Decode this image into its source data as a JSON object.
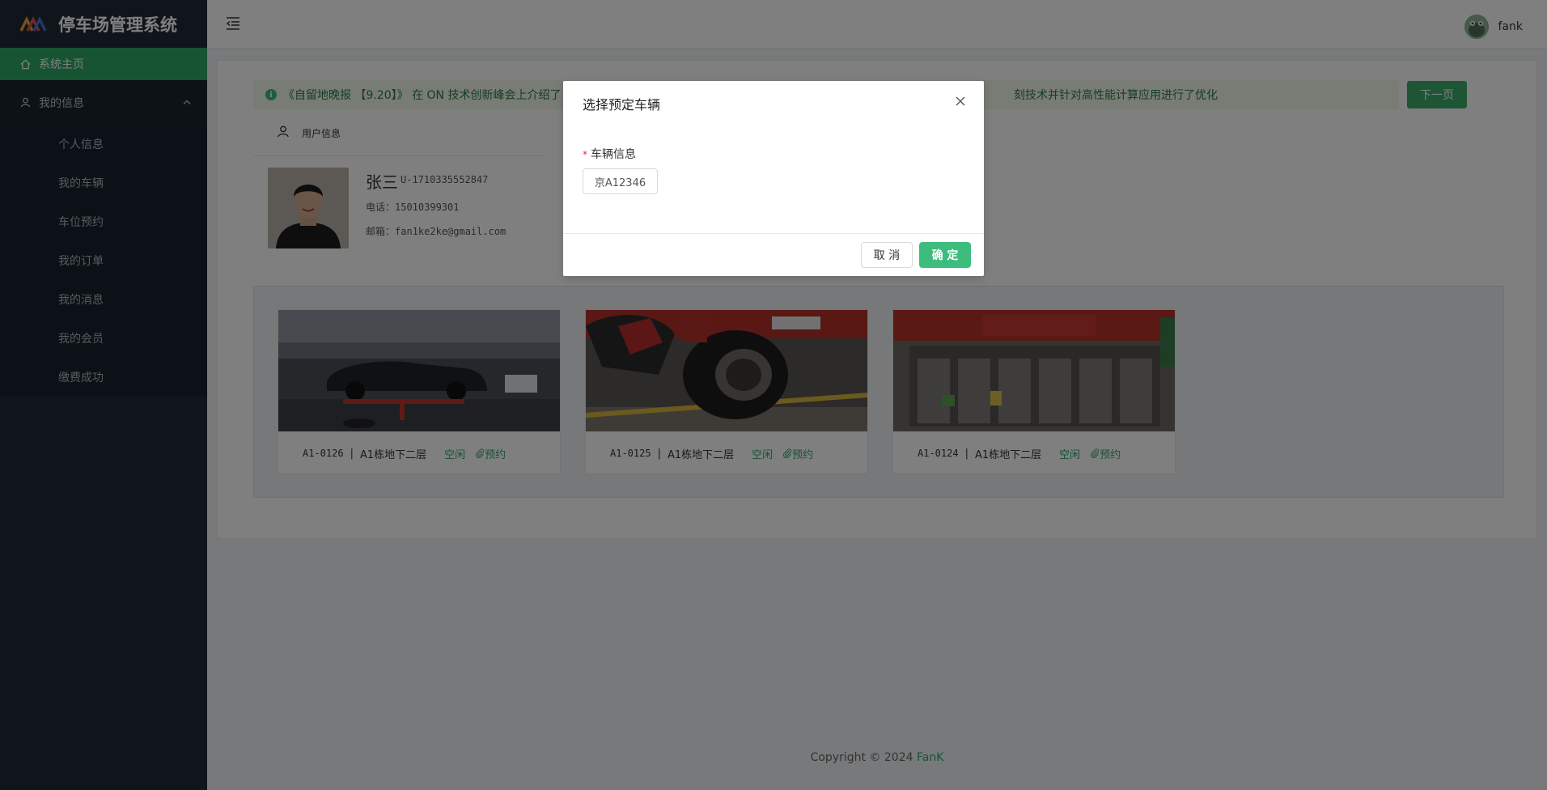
{
  "app": {
    "title": "停车场管理系统"
  },
  "sidebar": {
    "home": "系统主页",
    "my_info": "我的信息",
    "items": [
      {
        "label": "个人信息"
      },
      {
        "label": "我的车辆"
      },
      {
        "label": "车位预约"
      },
      {
        "label": "我的订单"
      },
      {
        "label": "我的消息"
      },
      {
        "label": "我的会员"
      },
      {
        "label": "缴费成功"
      }
    ]
  },
  "header": {
    "username": "fank"
  },
  "notice": {
    "text_left": "《自留地晚报 【9.20】》 在 ON 技术创新峰会上介绍了",
    "text_right": "刻技术并针对高性能计算应用进行了优化",
    "next_button": "下一页"
  },
  "profile": {
    "tab": "用户信息",
    "name": "张三",
    "id": "U-1710335552847",
    "phone": "电话：15010399301",
    "email": "邮箱：fan1ke2ke@gmail.com"
  },
  "spaces": [
    {
      "code": "A1-0126",
      "location": "A1栋地下二层",
      "status": "空闲",
      "action": "预约"
    },
    {
      "code": "A1-0125",
      "location": "A1栋地下二层",
      "status": "空闲",
      "action": "预约"
    },
    {
      "code": "A1-0124",
      "location": "A1栋地下二层",
      "status": "空闲",
      "action": "预约"
    }
  ],
  "footer": {
    "copyright": "Copyright © 2024 ",
    "brand": "FanK"
  },
  "modal": {
    "title": "选择预定车辆",
    "field_label": "车辆信息",
    "vehicle": "京A12346",
    "cancel": "取 消",
    "confirm": "确 定"
  },
  "colors": {
    "primary": "#2ea867",
    "sidebar_bg": "#1e2b36",
    "required": "#f5222d"
  },
  "icons": {
    "home": "home-icon",
    "user": "user-icon",
    "menu": "menu-fold-icon",
    "close": "close-icon",
    "info": "info-icon",
    "link": "paperclip-icon"
  }
}
